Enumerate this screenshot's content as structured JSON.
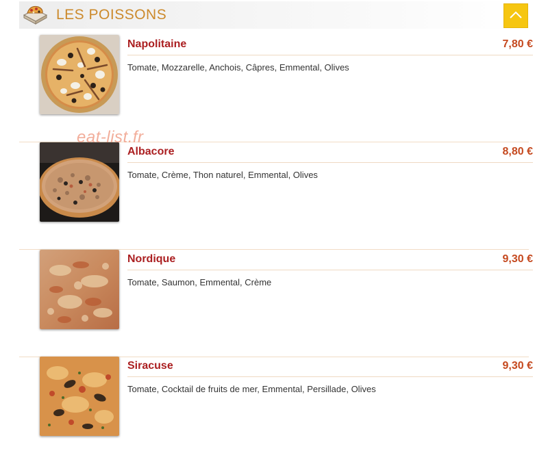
{
  "section": {
    "title": "LES POISSONS",
    "icon": "pizza-box-icon",
    "up_button_icon": "chevron-up-icon",
    "accent_color": "#f6c611"
  },
  "watermark": "eat-list.fr",
  "items": [
    {
      "name": "Napolitaine",
      "price": "7,80 €",
      "description": "Tomate, Mozzarelle, Anchois, Câpres, Emmental, Olives"
    },
    {
      "name": "Albacore",
      "price": "8,80 €",
      "description": "Tomate, Crème, Thon naturel, Emmental, Olives"
    },
    {
      "name": "Nordique",
      "price": "9,30 €",
      "description": "Tomate, Saumon, Emmental, Crème"
    },
    {
      "name": "Siracuse",
      "price": "9,30 €",
      "description": "Tomate, Cocktail de fruits de mer, Emmental, Persillade, Olives"
    }
  ],
  "colors": {
    "name": "#ab1f21",
    "price": "#c5491f",
    "section_title": "#cc8a2c"
  }
}
